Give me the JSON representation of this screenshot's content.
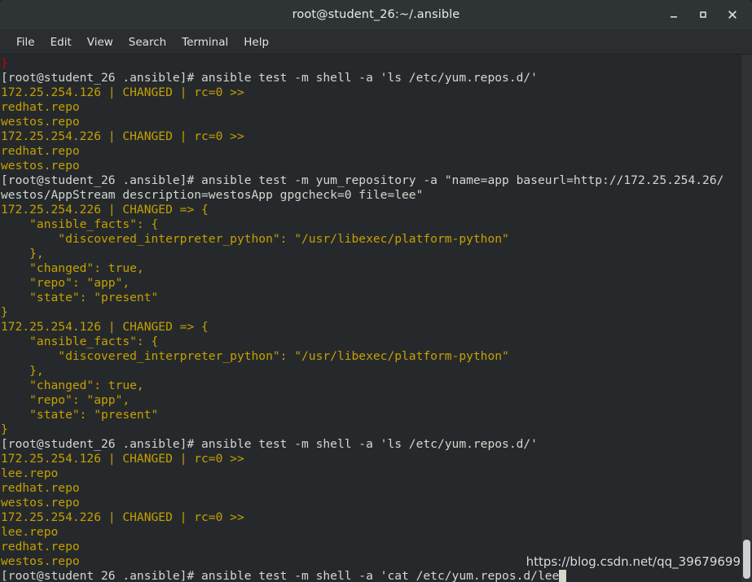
{
  "window": {
    "title": "root@student_26:~/.ansible",
    "controls": [
      {
        "name": "minimize-button",
        "glyph": "_"
      },
      {
        "name": "maximize-button",
        "glyph": "□"
      },
      {
        "name": "close-button",
        "glyph": "✕"
      }
    ]
  },
  "menubar": {
    "items": [
      {
        "label": "File"
      },
      {
        "label": "Edit"
      },
      {
        "label": "View"
      },
      {
        "label": "Search"
      },
      {
        "label": "Terminal"
      },
      {
        "label": "Help"
      }
    ]
  },
  "colors": {
    "titlebar_bg": "#2e3436",
    "menubar_bg": "#2a2e30",
    "terminal_bg": "#26292c",
    "prompt_fg": "#d3d7cf",
    "output_fg": "#c4a000",
    "error_fg": "#cc0000",
    "scrollbar_thumb": "#cfd2d3"
  },
  "terminal": {
    "prompt": "[root@student_26 .ansible]# ",
    "lines": [
      {
        "text": "}",
        "kind": "err"
      },
      {
        "text": "[root@student_26 .ansible]# ansible test -m shell -a 'ls /etc/yum.repos.d/'",
        "kind": "prompt"
      },
      {
        "text": "172.25.254.126 | CHANGED | rc=0 >>",
        "kind": "out"
      },
      {
        "text": "redhat.repo",
        "kind": "out"
      },
      {
        "text": "westos.repo",
        "kind": "out"
      },
      {
        "text": "172.25.254.226 | CHANGED | rc=0 >>",
        "kind": "out"
      },
      {
        "text": "redhat.repo",
        "kind": "out"
      },
      {
        "text": "westos.repo",
        "kind": "out"
      },
      {
        "text": "[root@student_26 .ansible]# ansible test -m yum_repository -a \"name=app baseurl=http://172.25.254.26/",
        "kind": "prompt"
      },
      {
        "text": "westos/AppStream description=westosApp gpgcheck=0 file=lee\"",
        "kind": "prompt"
      },
      {
        "text": "172.25.254.226 | CHANGED => {",
        "kind": "out"
      },
      {
        "text": "    \"ansible_facts\": {",
        "kind": "out"
      },
      {
        "text": "        \"discovered_interpreter_python\": \"/usr/libexec/platform-python\"",
        "kind": "out"
      },
      {
        "text": "    },",
        "kind": "out"
      },
      {
        "text": "    \"changed\": true,",
        "kind": "out"
      },
      {
        "text": "    \"repo\": \"app\",",
        "kind": "out"
      },
      {
        "text": "    \"state\": \"present\"",
        "kind": "out"
      },
      {
        "text": "}",
        "kind": "out"
      },
      {
        "text": "172.25.254.126 | CHANGED => {",
        "kind": "out"
      },
      {
        "text": "    \"ansible_facts\": {",
        "kind": "out"
      },
      {
        "text": "        \"discovered_interpreter_python\": \"/usr/libexec/platform-python\"",
        "kind": "out"
      },
      {
        "text": "    },",
        "kind": "out"
      },
      {
        "text": "    \"changed\": true,",
        "kind": "out"
      },
      {
        "text": "    \"repo\": \"app\",",
        "kind": "out"
      },
      {
        "text": "    \"state\": \"present\"",
        "kind": "out"
      },
      {
        "text": "}",
        "kind": "out"
      },
      {
        "text": "[root@student_26 .ansible]# ansible test -m shell -a 'ls /etc/yum.repos.d/'",
        "kind": "prompt"
      },
      {
        "text": "172.25.254.126 | CHANGED | rc=0 >>",
        "kind": "out"
      },
      {
        "text": "lee.repo",
        "kind": "out"
      },
      {
        "text": "redhat.repo",
        "kind": "out"
      },
      {
        "text": "westos.repo",
        "kind": "out"
      },
      {
        "text": "172.25.254.226 | CHANGED | rc=0 >>",
        "kind": "out"
      },
      {
        "text": "lee.repo",
        "kind": "out"
      },
      {
        "text": "redhat.repo",
        "kind": "out"
      },
      {
        "text": "westos.repo",
        "kind": "out"
      },
      {
        "text": "[root@student_26 .ansible]# ansible test -m shell -a 'cat /etc/yum.repos.d/lee",
        "kind": "prompt",
        "cursor": true
      }
    ]
  },
  "watermark": {
    "text": "https://blog.csdn.net/qq_39679699"
  }
}
